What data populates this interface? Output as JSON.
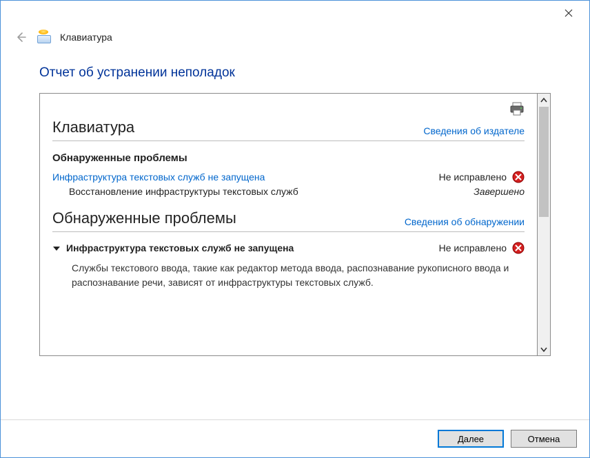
{
  "titlebar": {
    "close_label": "Close"
  },
  "header": {
    "app_name": "Клавиатура"
  },
  "page": {
    "title": "Отчет об устранении неполадок"
  },
  "report": {
    "section1": {
      "title": "Клавиатура",
      "publisher_link": "Сведения об издателе"
    },
    "found_heading": "Обнаруженные проблемы",
    "issue1": {
      "text": "Инфраструктура текстовых служб не запущена",
      "status": "Не исправлено"
    },
    "step1": {
      "text": "Восстановление инфраструктуры текстовых служб",
      "status": "Завершено"
    },
    "section2": {
      "title": "Обнаруженные проблемы",
      "detection_link": "Сведения об обнаружении"
    },
    "detail": {
      "title": "Инфраструктура текстовых служб не запущена",
      "status": "Не исправлено",
      "desc": "Службы текстового ввода, такие как редактор метода ввода, распознавание рукописного ввода и распознавание речи, зависят от инфраструктуры текстовых служб."
    }
  },
  "footer": {
    "next": "Далее",
    "cancel": "Отмена"
  }
}
